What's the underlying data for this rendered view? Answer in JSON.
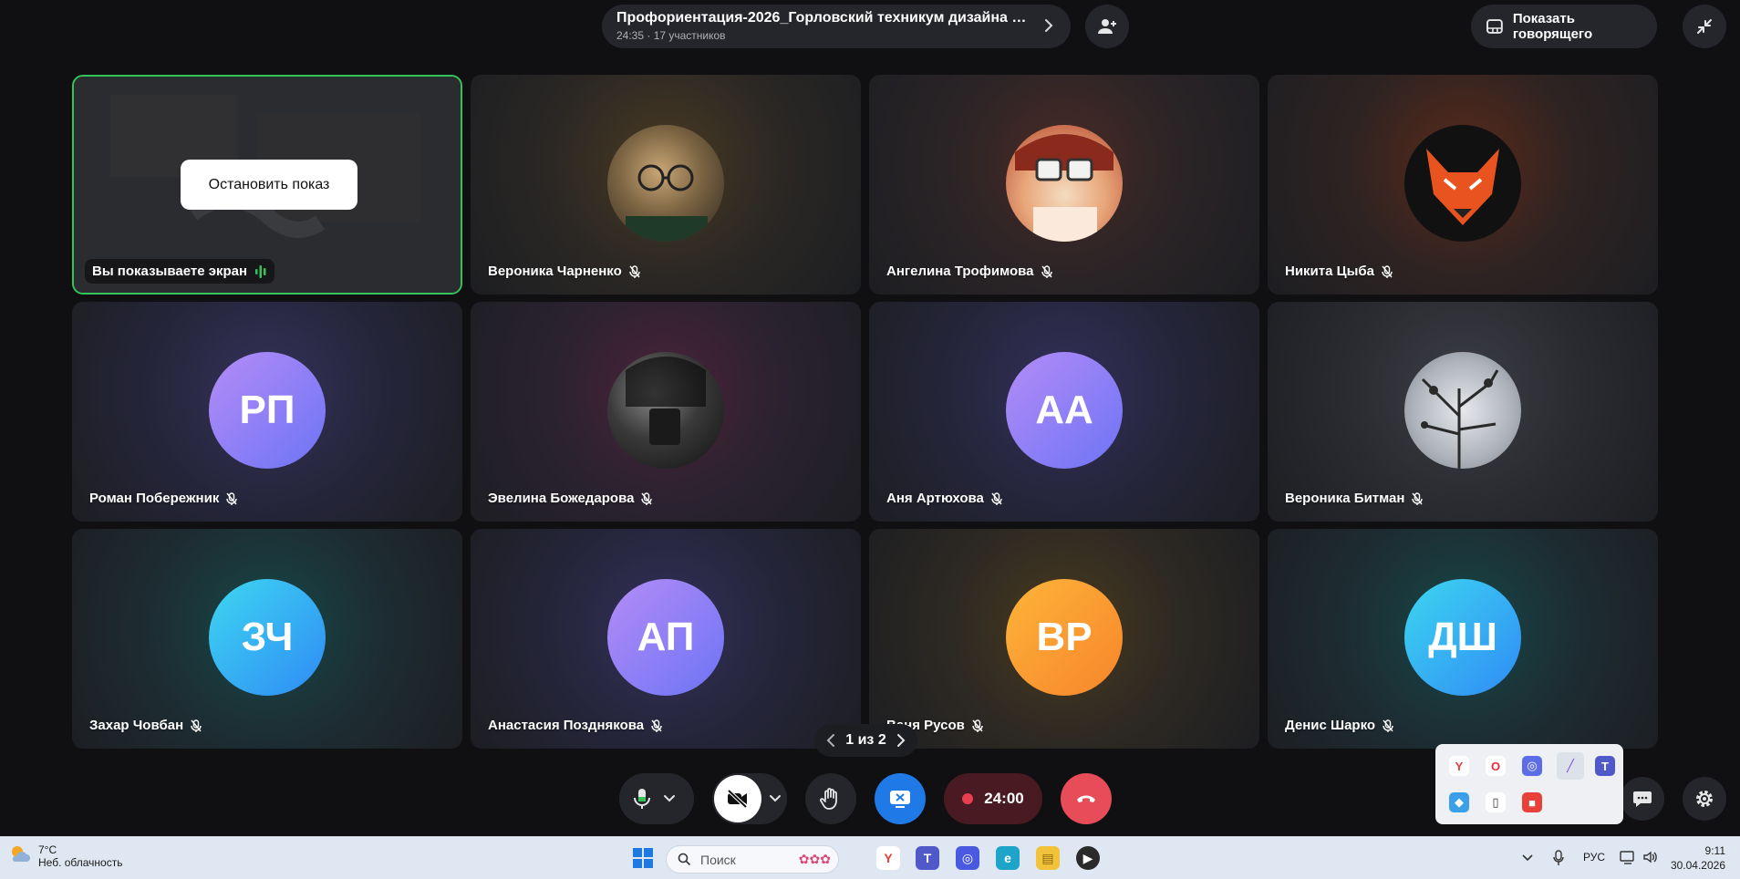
{
  "header": {
    "title": "Профориентация-2026_Горловский техникум дизайна и ...",
    "subtitle": "24:35 · 17 участников",
    "show_speaker_label": "Показать говорящего"
  },
  "share_tile": {
    "stop_label": "Остановить показ",
    "sharing_label": "Вы показываете экран"
  },
  "participants": [
    {
      "name": "Вероника Чарненко",
      "initials": ""
    },
    {
      "name": "Ангелина Трофимова",
      "initials": ""
    },
    {
      "name": "Никита Цыба",
      "initials": ""
    },
    {
      "name": "Роман Побережник",
      "initials": "РП"
    },
    {
      "name": "Эвелина Божедарова",
      "initials": ""
    },
    {
      "name": "Аня Артюхова",
      "initials": "АА"
    },
    {
      "name": "Вероника Битман",
      "initials": ""
    },
    {
      "name": "Захар Човбан",
      "initials": "ЗЧ"
    },
    {
      "name": "Анастасия Позднякова",
      "initials": "АП"
    },
    {
      "name": "Ваня Русов",
      "initials": "ВР"
    },
    {
      "name": "Денис Шарко",
      "initials": "ДШ"
    }
  ],
  "pager": {
    "label": "1 из 2"
  },
  "controls": {
    "timer": "24:00"
  },
  "taskbar": {
    "temperature": "7°C",
    "weather_desc": "Неб. облачность",
    "search_placeholder": "Поиск",
    "language": "РУС",
    "time": "9:11",
    "date": "30.04.2026"
  },
  "colors": {
    "share_border": "#33c45a",
    "avatar_purple": "#8b7cf6",
    "avatar_cyan": "#27b4f2",
    "avatar_orange": "#fb9a2a",
    "end_call": "#e84c58"
  }
}
